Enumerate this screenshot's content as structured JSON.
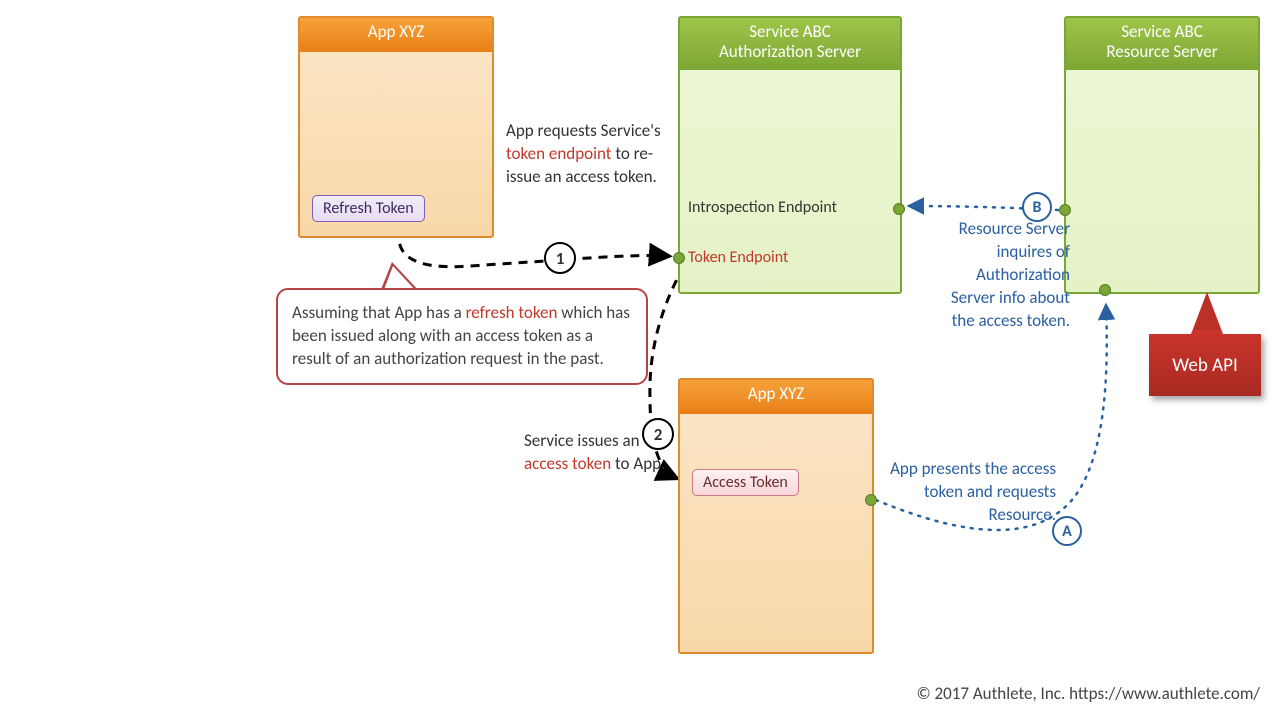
{
  "boxes": {
    "app1_title": "App XYZ",
    "auth_title": "Service ABC\nAuthorization Server",
    "res_title": "Service ABC\nResource Server",
    "app2_title": "App XYZ"
  },
  "tokens": {
    "refresh": "Refresh Token",
    "access": "Access Token"
  },
  "endpoints": {
    "introspection": "Introspection Endpoint",
    "token": "Token Endpoint"
  },
  "callout": {
    "pre": "Assuming that App has a ",
    "hl": "refresh token",
    "post": " which has been issued along with an access token as a result of an authorization request in the past."
  },
  "note1": {
    "pre": "App requests Service's ",
    "hl": "token endpoint",
    "post": " to re-issue an access token."
  },
  "note2": {
    "pre": "Service issues an ",
    "hl": "access token",
    "post": " to App."
  },
  "note3": "App presents the access token and requests Resource.",
  "note4": "Resource Server inquires of Authorization Server info about the access token.",
  "steps": {
    "s1": "1",
    "s2": "2",
    "sA": "A",
    "sB": "B"
  },
  "flag": "Web API",
  "footer": "© 2017 Authlete, Inc.  https://www.authlete.com/"
}
